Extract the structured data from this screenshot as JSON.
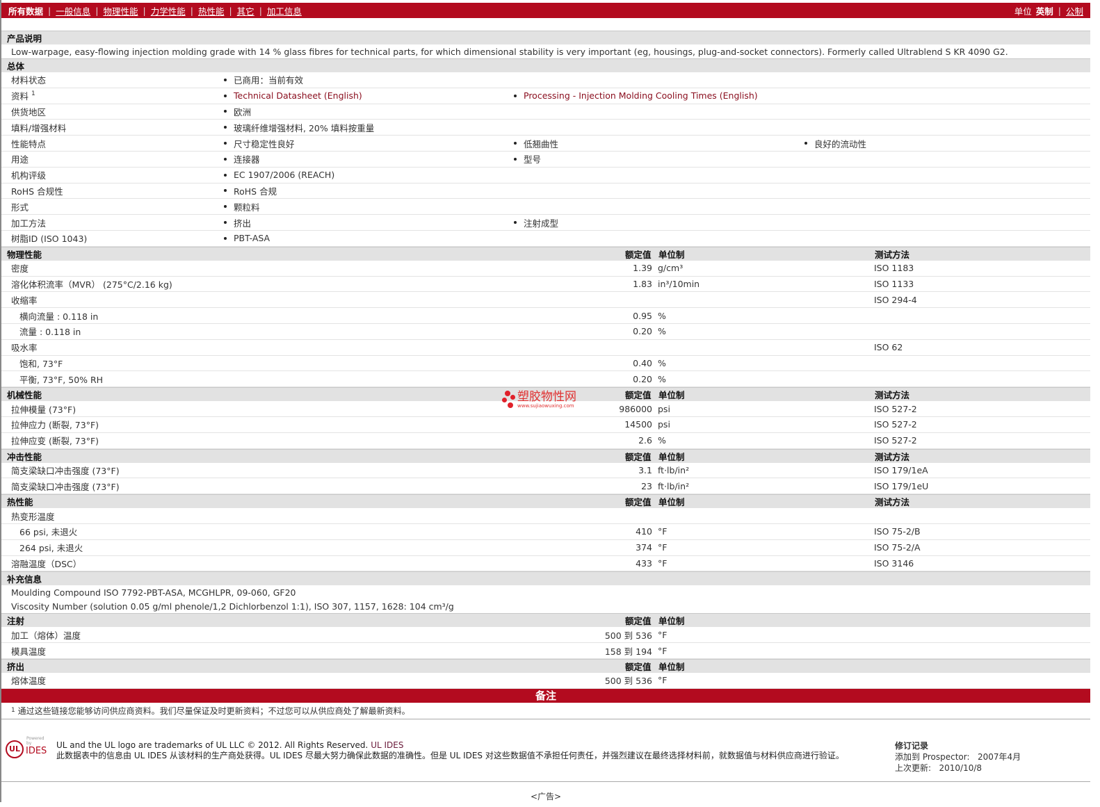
{
  "nav": {
    "tabs": [
      "所有数据",
      "一般信息",
      "物理性能",
      "力学性能",
      "热性能",
      "其它",
      "加工信息"
    ],
    "units_label": "单位",
    "unit_active": "英制",
    "unit_other": "公制"
  },
  "sections": [
    {
      "title": "产品说明",
      "type": "text",
      "lines": [
        "Low-warpage, easy-flowing injection molding grade with 14 % glass fibres for technical parts, for which dimensional stability is very important (eg, housings, plug-and-socket connectors). Formerly called Ultrablend S KR 4090 G2."
      ]
    },
    {
      "title": "总体",
      "type": "bullets",
      "rows": [
        {
          "label": "材料状态",
          "items": [
            "已商用：当前有效"
          ]
        },
        {
          "label": "资料",
          "sup": "1",
          "items": [
            "Technical Datasheet (English)",
            "Processing - Injection Molding Cooling Times (English)"
          ],
          "links": true
        },
        {
          "label": "供货地区",
          "items": [
            "欧洲"
          ]
        },
        {
          "label": "填料/增强材料",
          "items": [
            "玻璃纤维增强材料, 20% 填料按重量"
          ]
        },
        {
          "label": "性能特点",
          "items": [
            "尺寸稳定性良好",
            "低翘曲性",
            "良好的流动性"
          ]
        },
        {
          "label": "用途",
          "items": [
            "连接器",
            "型号"
          ]
        },
        {
          "label": "机构评级",
          "items": [
            "EC 1907/2006 (REACH)"
          ]
        },
        {
          "label": "RoHS 合规性",
          "items": [
            "RoHS 合规"
          ]
        },
        {
          "label": "形式",
          "items": [
            "颗粒料"
          ]
        },
        {
          "label": "加工方法",
          "items": [
            "挤出",
            "注射成型"
          ]
        },
        {
          "label": "树脂ID (ISO 1043)",
          "items": [
            "PBT-ASA"
          ]
        }
      ]
    },
    {
      "title": "物理性能",
      "type": "props",
      "cols": [
        "额定值",
        "单位制",
        "测试方法"
      ],
      "rows": [
        {
          "label": "密度",
          "value": "1.39",
          "unit": "g/cm³",
          "method": "ISO 1183"
        },
        {
          "label": "溶化体积流率（MVR）  (275°C/2.16 kg)",
          "value": "1.83",
          "unit": "in³/10min",
          "method": "ISO 1133"
        },
        {
          "label": "收缩率",
          "method": "ISO 294-4"
        },
        {
          "label": "横向流量 : 0.118 in",
          "indent": true,
          "value": "0.95",
          "unit": "%"
        },
        {
          "label": "流量 : 0.118 in",
          "indent": true,
          "value": "0.20",
          "unit": "%"
        },
        {
          "label": "吸水率",
          "method": "ISO 62"
        },
        {
          "label": "饱和, 73°F",
          "indent": true,
          "value": "0.40",
          "unit": "%"
        },
        {
          "label": "平衡, 73°F, 50% RH",
          "indent": true,
          "value": "0.20",
          "unit": "%"
        }
      ]
    },
    {
      "title": "机械性能",
      "type": "props",
      "cols": [
        "额定值",
        "单位制",
        "测试方法"
      ],
      "rows": [
        {
          "label": "拉伸模量  (73°F)",
          "value": "986000",
          "unit": "psi",
          "method": "ISO 527-2"
        },
        {
          "label": "拉伸应力  (断裂, 73°F)",
          "value": "14500",
          "unit": "psi",
          "method": "ISO 527-2"
        },
        {
          "label": "拉伸应变  (断裂, 73°F)",
          "value": "2.6",
          "unit": "%",
          "method": "ISO 527-2"
        }
      ]
    },
    {
      "title": "冲击性能",
      "type": "props",
      "cols": [
        "额定值",
        "单位制",
        "测试方法"
      ],
      "rows": [
        {
          "label": "简支梁缺口冲击强度  (73°F)",
          "value": "3.1",
          "unit": "ft·lb/in²",
          "method": "ISO 179/1eA"
        },
        {
          "label": "简支梁缺口冲击强度  (73°F)",
          "value": "23",
          "unit": "ft·lb/in²",
          "method": "ISO 179/1eU"
        }
      ]
    },
    {
      "title": "热性能",
      "type": "props",
      "cols": [
        "额定值",
        "单位制",
        "测试方法"
      ],
      "rows": [
        {
          "label": "热变形温度"
        },
        {
          "label": "66 psi, 未退火",
          "indent": true,
          "value": "410",
          "unit": "°F",
          "method": "ISO 75-2/B"
        },
        {
          "label": "264 psi, 未退火",
          "indent": true,
          "value": "374",
          "unit": "°F",
          "method": "ISO 75-2/A"
        },
        {
          "label": "溶融温度（DSC）",
          "value": "433",
          "unit": "°F",
          "method": "ISO 3146"
        }
      ]
    },
    {
      "title": "补充信息",
      "type": "text",
      "lines": [
        "Moulding Compound ISO 7792-PBT-ASA, MCGHLPR, 09-060, GF20",
        "Viscosity Number (solution 0.05 g/ml phenole/1,2 Dichlorbenzol 1:1), ISO 307, 1157, 1628: 104 cm³/g"
      ]
    },
    {
      "title": "注射",
      "type": "props",
      "cols": [
        "额定值",
        "单位制",
        ""
      ],
      "rows": [
        {
          "label": "加工（熔体）温度",
          "value": "500 到  536",
          "unit": "°F"
        },
        {
          "label": "模具温度",
          "value": "158 到  194",
          "unit": "°F"
        }
      ]
    },
    {
      "title": "挤出",
      "type": "props",
      "cols": [
        "额定值",
        "单位制",
        ""
      ],
      "rows": [
        {
          "label": "熔体温度",
          "value": "500 到  536",
          "unit": "°F"
        }
      ]
    }
  ],
  "notes": {
    "title": "备注",
    "sup": "1",
    "text": "通过这些链接您能够访问供应商资料。我们尽量保证及时更新资料；不过您可以从供应商处了解最新资料。"
  },
  "footer": {
    "logo": "UL IDES",
    "powered": "Powered by",
    "trademark": "UL and the UL logo are trademarks of UL LLC © 2012. All Rights Reserved.",
    "trademark_link": "UL IDES",
    "disclaimer": "此数据表中的信息由  UL IDES 从该材料的生产商处获得。UL IDES 尽最大努力确保此数据的准确性。但是  UL IDES 对这些数据值不承担任何责任，并强烈建议在最终选择材料前，就数据值与材料供应商进行验证。",
    "rev_title": "修订记录",
    "added_label": "添加到  Prospector:",
    "added_value": "2007年4月",
    "updated_label": "上次更新:",
    "updated_value": "2010/10/8"
  },
  "ad": "<广告>",
  "watermark": {
    "name": "塑胶物性网",
    "url": "www.sujiaowuxing.com"
  }
}
